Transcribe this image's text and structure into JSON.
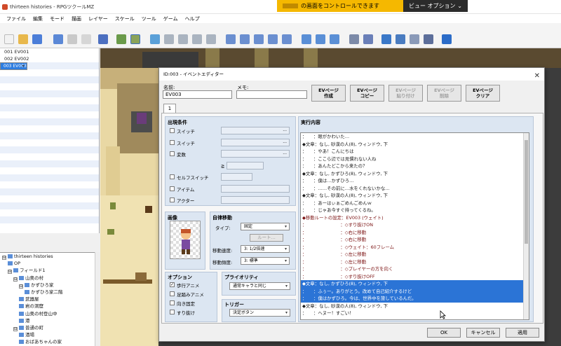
{
  "share_bar": {
    "message": "の画面をコントロールできます",
    "view_options": "ビュー オプション",
    "chevron": "⌄"
  },
  "app": {
    "title": "thirteen histories - RPGツクールMZ"
  },
  "menu": [
    "ファイル",
    "編集",
    "モード",
    "描画",
    "レイヤー",
    "スケール",
    "ツール",
    "ゲーム",
    "ヘルプ"
  ],
  "events": [
    {
      "text": "001 EV001",
      "selected": false
    },
    {
      "text": "002 EV002",
      "selected": false
    },
    {
      "text": "003 EV003",
      "selected": true
    }
  ],
  "map_tree": [
    {
      "label": "thirteen histories",
      "depth": 0,
      "toggle": "⊟"
    },
    {
      "label": "OP",
      "depth": 1,
      "toggle": ""
    },
    {
      "label": "フィールド1",
      "depth": 1,
      "toggle": "⊟"
    },
    {
      "label": "山奥の村",
      "depth": 2,
      "toggle": "⊟"
    },
    {
      "label": "かずひろ家",
      "depth": 3,
      "toggle": "⊟"
    },
    {
      "label": "かずひろ家二階",
      "depth": 4,
      "toggle": ""
    },
    {
      "label": "武器屋",
      "depth": 3,
      "toggle": ""
    },
    {
      "label": "岩の洞窟",
      "depth": 3,
      "toggle": ""
    },
    {
      "label": "山奥の村登山中",
      "depth": 3,
      "toggle": ""
    },
    {
      "label": "港",
      "depth": 3,
      "toggle": ""
    },
    {
      "label": "普通の町",
      "depth": 2,
      "toggle": "⊟"
    },
    {
      "label": "酒場",
      "depth": 3,
      "toggle": ""
    },
    {
      "label": "おばあちゃんの家",
      "depth": 3,
      "toggle": ""
    }
  ],
  "dialog": {
    "title": "ID:003 - イベントエディター",
    "close": "✕",
    "name_label": "名前:",
    "name_value": "EV003",
    "memo_label": "メモ:",
    "memo_value": "",
    "page_buttons": [
      {
        "line1": "EVページ",
        "line2": "作成",
        "enabled": true
      },
      {
        "line1": "EVページ",
        "line2": "コピー",
        "enabled": true
      },
      {
        "line1": "EVページ",
        "line2": "貼り付け",
        "enabled": false
      },
      {
        "line1": "EVページ",
        "line2": "削除",
        "enabled": false
      },
      {
        "line1": "EVページ",
        "line2": "クリア",
        "enabled": true
      }
    ],
    "tab": "1",
    "conditions": {
      "title": "出現条件",
      "switch1": "スイッチ",
      "switch2": "スイッチ",
      "variable": "変数",
      "gte": "≧",
      "self_switch": "セルフスイッチ",
      "item": "アイテム",
      "actor": "アクター"
    },
    "image_title": "画像",
    "autonomous": {
      "title": "自律移動",
      "type_label": "タイプ:",
      "type_value": "固定",
      "route_button": "ルート...",
      "speed_label": "移動速度:",
      "speed_value": "3: 1/2倍速",
      "freq_label": "移動頻度:",
      "freq_value": "3: 標準"
    },
    "options": {
      "title": "オプション",
      "walking": "歩行アニメ",
      "stepping": "足踏みアニメ",
      "direction_fix": "向き固定",
      "through": "すり抜け",
      "walking_checked": true
    },
    "priority": {
      "title": "プライオリティ",
      "value": "通常キャラと同じ"
    },
    "trigger": {
      "title": "トリガー",
      "value": "決定ボタン"
    },
    "contents_title": "実行内容",
    "commands": [
      {
        "text": "：　　：眼がかわいた…",
        "color": "#1a1a1a",
        "hl": false
      },
      {
        "text": "◆文章：なし, 砂漠の人(8), ウィンドウ, 下",
        "color": "#1a1a1a",
        "hl": false
      },
      {
        "text": "：　　：やあ！こんにちは",
        "color": "#1a1a1a",
        "hl": false
      },
      {
        "text": "：　　：ここら辺では見慣れない人ね",
        "color": "#1a1a1a",
        "hl": false
      },
      {
        "text": "：　　：あんたどこから来たの？",
        "color": "#1a1a1a",
        "hl": false
      },
      {
        "text": "◆文章：なし, かずひろ(8), ウィンドウ, 下",
        "color": "#1a1a1a",
        "hl": false
      },
      {
        "text": "：　　：僕は…かずひろ…",
        "color": "#1a1a1a",
        "hl": false
      },
      {
        "text": "：　　：……その前に…水をくれないかな…",
        "color": "#1a1a1a",
        "hl": false
      },
      {
        "text": "◆文章：なし, 砂漠の人(8), ウィンドウ, 下",
        "color": "#1a1a1a",
        "hl": false
      },
      {
        "text": "：　　：あーはぃぁごめんごめんｗ",
        "color": "#1a1a1a",
        "hl": false
      },
      {
        "text": "：　　：じゃあ今すぐ持ってくるね。",
        "color": "#1a1a1a",
        "hl": false
      },
      {
        "text": "◆移動ルートの設定：EV003 (ウェイト)",
        "color": "#7a1010",
        "hl": false
      },
      {
        "text": "：　　　　　　　　：◇すり抜けON",
        "color": "#7a1010",
        "hl": false
      },
      {
        "text": "：　　　　　　　　：◇右に移動",
        "color": "#7a1010",
        "hl": false
      },
      {
        "text": "：　　　　　　　　：◇右に移動",
        "color": "#7a1010",
        "hl": false
      },
      {
        "text": "：　　　　　　　　：◇ウェイト：60フレーム",
        "color": "#7a1010",
        "hl": false
      },
      {
        "text": "：　　　　　　　　：◇左に移動",
        "color": "#7a1010",
        "hl": false
      },
      {
        "text": "：　　　　　　　　：◇左に移動",
        "color": "#7a1010",
        "hl": false
      },
      {
        "text": "：　　　　　　　　：◇プレイヤーの方を向く",
        "color": "#7a1010",
        "hl": false
      },
      {
        "text": "：　　　　　　　　：◇すり抜けOFF",
        "color": "#7a1010",
        "hl": false
      },
      {
        "text": "◆文章：なし, かずひろ(8), ウィンドウ, 下",
        "color": "#ffffff",
        "hl": true
      },
      {
        "text": "：　　：ふぅー。ありがとう。改めて自己紹介するけど",
        "color": "#ffffff",
        "hl": true
      },
      {
        "text": "：　　：僕はかずひろ。今は、世界中を旅しているんだ。",
        "color": "#ffffff",
        "hl": true
      },
      {
        "text": "◆文章：なし, 砂漠の人(8), ウィンドウ, 下",
        "color": "#1a1a1a",
        "hl": false
      },
      {
        "text": "：　　：ヘヌー！すごい！",
        "color": "#1a1a1a",
        "hl": false
      },
      {
        "text": "◆",
        "color": "#1a1a1a",
        "hl": false
      }
    ],
    "ok": "OK",
    "cancel": "キャンセル",
    "apply": "適用",
    "ellipsis": "..."
  }
}
